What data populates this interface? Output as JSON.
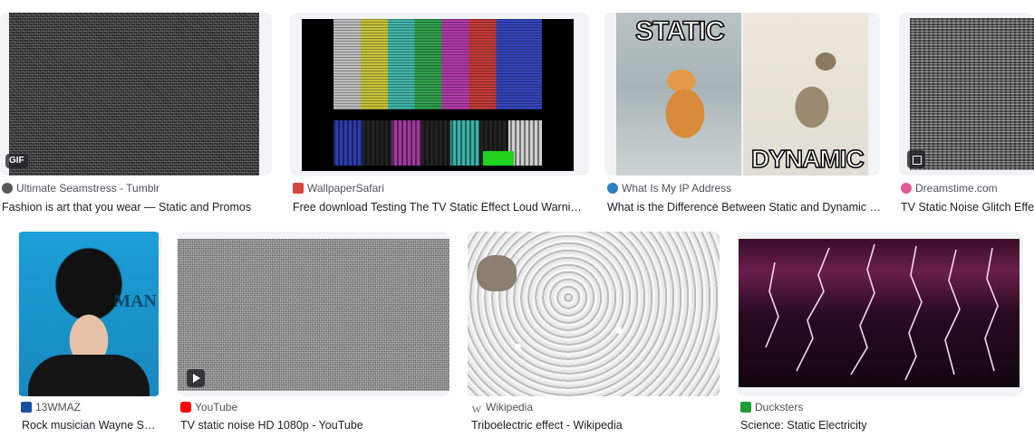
{
  "results": [
    {
      "source": "Ultimate Seamstress - Tumblr",
      "title": "Fashion is art that you wear — Static and Promos",
      "badge": "GIF",
      "favicon_color": "#595959"
    },
    {
      "source": "WallpaperSafari",
      "title": "Free download Testing The TV Static Effect Loud Warnin...",
      "favicon_color": "#d2483c"
    },
    {
      "source": "What Is My IP Address",
      "title": "What is the Difference Between Static and Dynamic I...",
      "favicon_color": "#2f7fc2",
      "meme_top": "STATIC",
      "meme_bottom": "DYNAMIC"
    },
    {
      "source": "Dreamstime.com",
      "title": "TV Static Noise Glitch Effect",
      "favicon_color": "#e05a9a"
    },
    {
      "source": "13WMAZ",
      "title": "Rock musician Wayne St...",
      "favicon_color": "#1a4fa0"
    },
    {
      "source": "YouTube",
      "title": "TV static noise HD 1080p - YouTube",
      "favicon_color": "#ff0000"
    },
    {
      "source": "Wikipedia",
      "title": "Triboelectric effect - Wikipedia",
      "favicon_color": "#666666"
    },
    {
      "source": "Ducksters",
      "title": "Science: Static Electricity",
      "favicon_color": "#1f9d37"
    }
  ]
}
